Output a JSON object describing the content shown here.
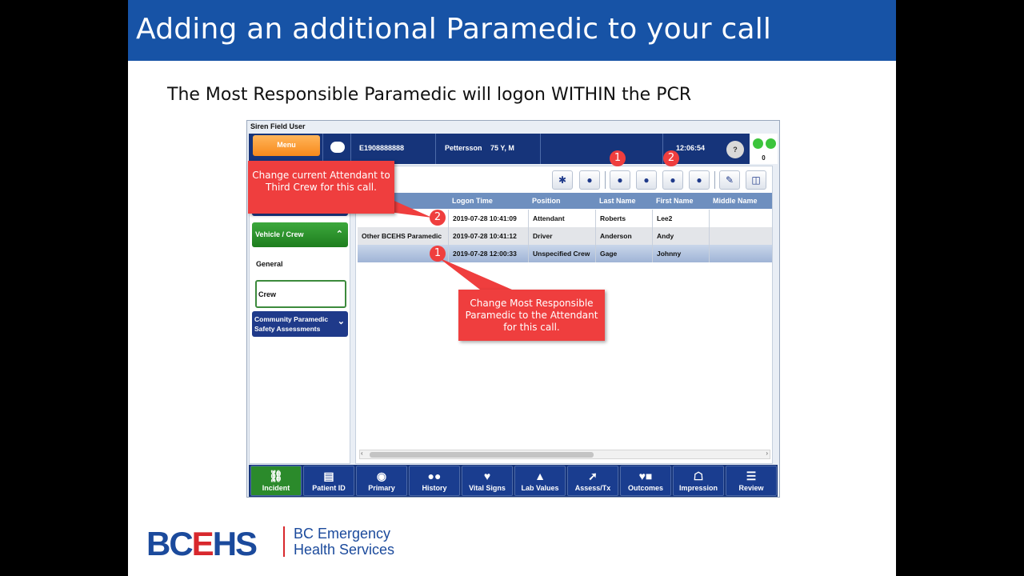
{
  "slide": {
    "title": "Adding an additional Paramedic to your call",
    "subtitle": "The Most Responsible Paramedic will logon WITHIN the PCR"
  },
  "window": {
    "title": "Siren Field User",
    "menu_label": "Menu",
    "incident_id": "E1908888888",
    "patient_name": "Pettersson",
    "patient_info": "75 Y, M",
    "time": "12:06:54",
    "help_label": "?",
    "status_count": "0"
  },
  "sidebar": {
    "vehicle_crew": "Vehicle / Crew",
    "general": "General",
    "crew": "Crew",
    "community_line1": "Community Paramedic",
    "community_line2": "Safety Assessments"
  },
  "grid": {
    "columns": [
      "e",
      "Logon Time",
      "Position",
      "Last Name",
      "First Name",
      "Middle Name"
    ],
    "rows": [
      {
        "role": "",
        "logon": "2019-07-28  10:41:09",
        "position": "Attendant",
        "last": "Roberts",
        "first": "Lee2",
        "middle": ""
      },
      {
        "role": "Other BCEHS Paramedic",
        "logon": "2019-07-28  10:41:12",
        "position": "Driver",
        "last": "Anderson",
        "first": "Andy",
        "middle": ""
      },
      {
        "role": "",
        "logon": "2019-07-28  12:00:33",
        "position": "Unspecified Crew",
        "last": "Gage",
        "first": "Johnny",
        "middle": ""
      }
    ]
  },
  "bottom_nav": [
    {
      "label": "Incident",
      "icon": "ambulance-icon"
    },
    {
      "label": "Patient ID",
      "icon": "id-card-icon"
    },
    {
      "label": "Primary",
      "icon": "eye-icon"
    },
    {
      "label": "History",
      "icon": "history-icon"
    },
    {
      "label": "Vital Signs",
      "icon": "heart-icon"
    },
    {
      "label": "Lab Values",
      "icon": "flask-icon"
    },
    {
      "label": "Assess/Tx",
      "icon": "syringe-icon"
    },
    {
      "label": "Outcomes",
      "icon": "outcomes-icon"
    },
    {
      "label": "Impression",
      "icon": "impression-icon"
    },
    {
      "label": "Review",
      "icon": "clipboard-icon"
    }
  ],
  "annotations": {
    "callout_top": "Change current Attendant to Third Crew for this call.",
    "callout_bottom": "Change Most Responsible Paramedic to the Attendant for this call.",
    "badge_1": "1",
    "badge_2": "2"
  },
  "logo": {
    "acronym_a": "BC",
    "acronym_b": "E",
    "acronym_c": "HS",
    "name_line1": "BC Emergency",
    "name_line2": "Health Services"
  },
  "colors": {
    "title_bar": "#1753a6",
    "callout_red": "#ef3e3e",
    "nav_blue": "#16347a",
    "active_green": "#2b8a2b"
  }
}
